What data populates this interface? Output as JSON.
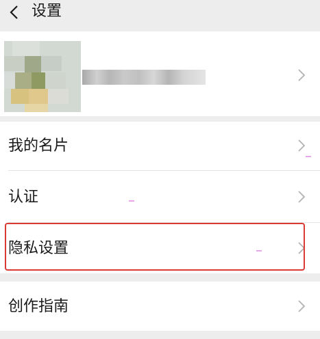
{
  "header": {
    "title": "设置"
  },
  "menu": {
    "my_card": "我的名片",
    "certification": "认证",
    "privacy_settings": "隐私设置",
    "creation_guide": "创作指南"
  },
  "colors": {
    "highlight_border": "#d93a34",
    "page_background": "#ededed",
    "row_background": "#ffffff",
    "chevron": "#b2b2b2"
  },
  "icons": {
    "back": "chevron-left-icon",
    "row_arrow": "chevron-right-icon"
  }
}
